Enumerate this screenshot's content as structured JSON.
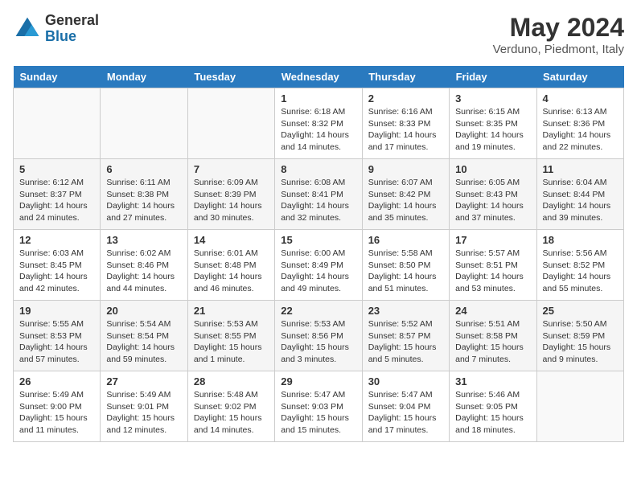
{
  "header": {
    "logo_general": "General",
    "logo_blue": "Blue",
    "month_year": "May 2024",
    "location": "Verduno, Piedmont, Italy"
  },
  "days_of_week": [
    "Sunday",
    "Monday",
    "Tuesday",
    "Wednesday",
    "Thursday",
    "Friday",
    "Saturday"
  ],
  "weeks": [
    [
      {
        "day": "",
        "info": ""
      },
      {
        "day": "",
        "info": ""
      },
      {
        "day": "",
        "info": ""
      },
      {
        "day": "1",
        "info": "Sunrise: 6:18 AM\nSunset: 8:32 PM\nDaylight: 14 hours\nand 14 minutes."
      },
      {
        "day": "2",
        "info": "Sunrise: 6:16 AM\nSunset: 8:33 PM\nDaylight: 14 hours\nand 17 minutes."
      },
      {
        "day": "3",
        "info": "Sunrise: 6:15 AM\nSunset: 8:35 PM\nDaylight: 14 hours\nand 19 minutes."
      },
      {
        "day": "4",
        "info": "Sunrise: 6:13 AM\nSunset: 8:36 PM\nDaylight: 14 hours\nand 22 minutes."
      }
    ],
    [
      {
        "day": "5",
        "info": "Sunrise: 6:12 AM\nSunset: 8:37 PM\nDaylight: 14 hours\nand 24 minutes."
      },
      {
        "day": "6",
        "info": "Sunrise: 6:11 AM\nSunset: 8:38 PM\nDaylight: 14 hours\nand 27 minutes."
      },
      {
        "day": "7",
        "info": "Sunrise: 6:09 AM\nSunset: 8:39 PM\nDaylight: 14 hours\nand 30 minutes."
      },
      {
        "day": "8",
        "info": "Sunrise: 6:08 AM\nSunset: 8:41 PM\nDaylight: 14 hours\nand 32 minutes."
      },
      {
        "day": "9",
        "info": "Sunrise: 6:07 AM\nSunset: 8:42 PM\nDaylight: 14 hours\nand 35 minutes."
      },
      {
        "day": "10",
        "info": "Sunrise: 6:05 AM\nSunset: 8:43 PM\nDaylight: 14 hours\nand 37 minutes."
      },
      {
        "day": "11",
        "info": "Sunrise: 6:04 AM\nSunset: 8:44 PM\nDaylight: 14 hours\nand 39 minutes."
      }
    ],
    [
      {
        "day": "12",
        "info": "Sunrise: 6:03 AM\nSunset: 8:45 PM\nDaylight: 14 hours\nand 42 minutes."
      },
      {
        "day": "13",
        "info": "Sunrise: 6:02 AM\nSunset: 8:46 PM\nDaylight: 14 hours\nand 44 minutes."
      },
      {
        "day": "14",
        "info": "Sunrise: 6:01 AM\nSunset: 8:48 PM\nDaylight: 14 hours\nand 46 minutes."
      },
      {
        "day": "15",
        "info": "Sunrise: 6:00 AM\nSunset: 8:49 PM\nDaylight: 14 hours\nand 49 minutes."
      },
      {
        "day": "16",
        "info": "Sunrise: 5:58 AM\nSunset: 8:50 PM\nDaylight: 14 hours\nand 51 minutes."
      },
      {
        "day": "17",
        "info": "Sunrise: 5:57 AM\nSunset: 8:51 PM\nDaylight: 14 hours\nand 53 minutes."
      },
      {
        "day": "18",
        "info": "Sunrise: 5:56 AM\nSunset: 8:52 PM\nDaylight: 14 hours\nand 55 minutes."
      }
    ],
    [
      {
        "day": "19",
        "info": "Sunrise: 5:55 AM\nSunset: 8:53 PM\nDaylight: 14 hours\nand 57 minutes."
      },
      {
        "day": "20",
        "info": "Sunrise: 5:54 AM\nSunset: 8:54 PM\nDaylight: 14 hours\nand 59 minutes."
      },
      {
        "day": "21",
        "info": "Sunrise: 5:53 AM\nSunset: 8:55 PM\nDaylight: 15 hours\nand 1 minute."
      },
      {
        "day": "22",
        "info": "Sunrise: 5:53 AM\nSunset: 8:56 PM\nDaylight: 15 hours\nand 3 minutes."
      },
      {
        "day": "23",
        "info": "Sunrise: 5:52 AM\nSunset: 8:57 PM\nDaylight: 15 hours\nand 5 minutes."
      },
      {
        "day": "24",
        "info": "Sunrise: 5:51 AM\nSunset: 8:58 PM\nDaylight: 15 hours\nand 7 minutes."
      },
      {
        "day": "25",
        "info": "Sunrise: 5:50 AM\nSunset: 8:59 PM\nDaylight: 15 hours\nand 9 minutes."
      }
    ],
    [
      {
        "day": "26",
        "info": "Sunrise: 5:49 AM\nSunset: 9:00 PM\nDaylight: 15 hours\nand 11 minutes."
      },
      {
        "day": "27",
        "info": "Sunrise: 5:49 AM\nSunset: 9:01 PM\nDaylight: 15 hours\nand 12 minutes."
      },
      {
        "day": "28",
        "info": "Sunrise: 5:48 AM\nSunset: 9:02 PM\nDaylight: 15 hours\nand 14 minutes."
      },
      {
        "day": "29",
        "info": "Sunrise: 5:47 AM\nSunset: 9:03 PM\nDaylight: 15 hours\nand 15 minutes."
      },
      {
        "day": "30",
        "info": "Sunrise: 5:47 AM\nSunset: 9:04 PM\nDaylight: 15 hours\nand 17 minutes."
      },
      {
        "day": "31",
        "info": "Sunrise: 5:46 AM\nSunset: 9:05 PM\nDaylight: 15 hours\nand 18 minutes."
      },
      {
        "day": "",
        "info": ""
      }
    ]
  ]
}
